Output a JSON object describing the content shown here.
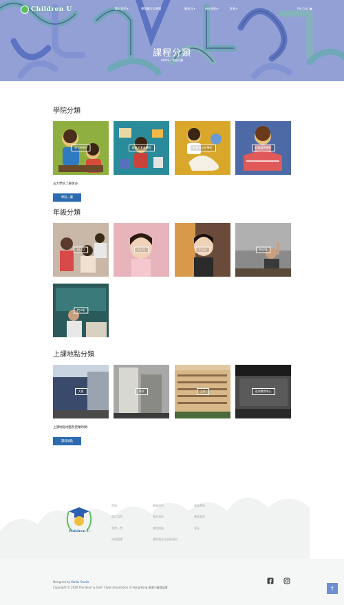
{
  "nav": {
    "logo_text": "Children U",
    "items": [
      "關於我們",
      "學院簡介及學費",
      "開放日",
      "報名須知",
      "家長",
      "My Cart"
    ]
  },
  "hero": {
    "title": "課程分類",
    "breadcrumb": "HOME / 課程分類"
  },
  "colleges": {
    "title": "學院分類",
    "tiles": [
      "STEM學院",
      "表達與溝通學院",
      "科學與自然學院",
      "創意藝術學院"
    ],
    "note": "五大學院了解更多：",
    "button": "學院一覽"
  },
  "grades": {
    "title": "年級分類",
    "tiles": [
      "K1-K2",
      "K3-P1",
      "P1-P2",
      "P3-P4",
      "P5-P6"
    ]
  },
  "locations": {
    "title": "上課地點分類",
    "tiles": [
      "大角",
      "灣仔",
      "上水",
      "荃灣教育中心"
    ],
    "note": "上課地點地圖及營業時間：",
    "button": "課程地點"
  },
  "footer": {
    "links": [
      [
        "首頁",
        "最新消息",
        "會員專區"
      ],
      [
        "關於我們",
        "報名須知",
        "聯絡我們"
      ],
      [
        "學院一覽",
        "課程地點",
        "家長"
      ],
      [
        "年級選擇",
        "課程報名及退款須知",
        ""
      ]
    ],
    "logo_text": "Children U",
    "designed_prefix": "Designed by",
    "designed_brand": "Media Studio",
    "copyright": "Copyright © 2020 The Boys' & Girls' Clubs Association of Hong Kong 香港小童群益會",
    "totop": "↑"
  },
  "colors": {
    "accent": "#2c6bb0",
    "hero": "#9aa6d6"
  }
}
